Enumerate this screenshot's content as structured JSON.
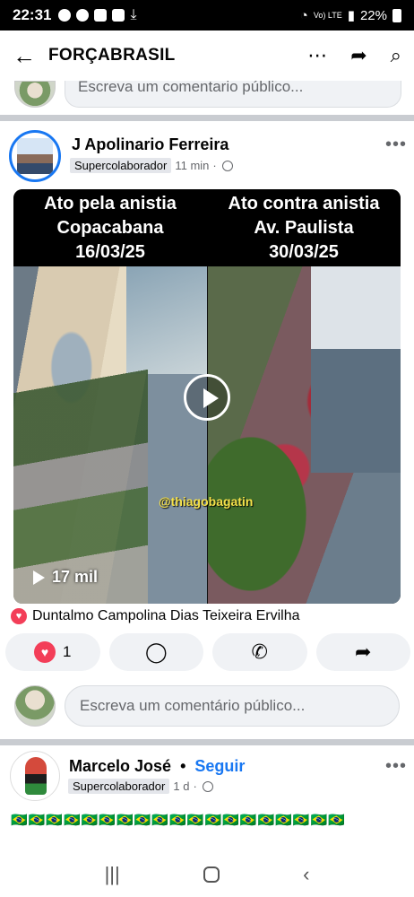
{
  "status_bar": {
    "time": "22:31",
    "network": "Vo) LTE",
    "battery": "22%"
  },
  "app_bar": {
    "title": "FORÇABRASIL"
  },
  "top_comment": {
    "placeholder": "Escreva um comentario público..."
  },
  "post": {
    "author": "J Apolinario Ferreira",
    "badge": "Supercolaborador",
    "time": "11 min",
    "video": {
      "left_caption": [
        "Ato pela anistia",
        "Copacabana",
        "16/03/25"
      ],
      "right_caption": [
        "Ato contra anistia",
        "Av. Paulista",
        "30/03/25"
      ],
      "watermark": "@thiagobagatin",
      "views": "17 mil"
    },
    "reacted_by": "Duntalmo Campolina Dias Teixeira Ervilha",
    "reaction_count": "1"
  },
  "comment_input": {
    "placeholder": "Escreva um comentário público..."
  },
  "post2": {
    "author": "Marcelo José",
    "follow": "Seguir",
    "badge": "Supercolaborador",
    "time": "1 d",
    "flags": "🇧🇷🇧🇷🇧🇷🇧🇷🇧🇷🇧🇷🇧🇷🇧🇷🇧🇷🇧🇷🇧🇷🇧🇷🇧🇷🇧🇷🇧🇷🇧🇷🇧🇷🇧🇷🇧🇷"
  },
  "icons": {
    "back": "arrow-left-icon",
    "more": "more-icon",
    "share": "share-icon",
    "search": "search-icon",
    "comment": "comment-icon",
    "whatsapp": "whatsapp-icon",
    "forward": "forward-icon"
  },
  "colors": {
    "accent": "#1877f2",
    "reaction": "#f33e58"
  }
}
